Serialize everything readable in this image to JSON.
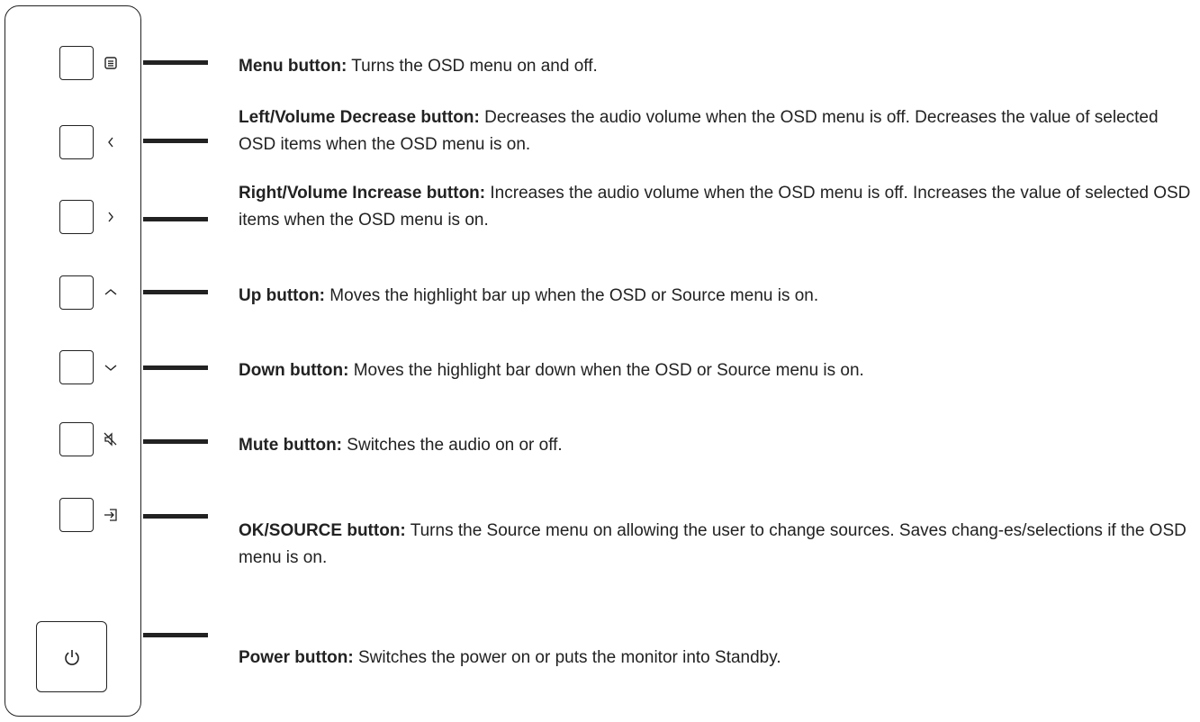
{
  "buttons": [
    {
      "id": "menu",
      "icon": "menu-icon",
      "label": "Menu button:",
      "text": "Turns the OSD menu on and off."
    },
    {
      "id": "left",
      "icon": "chevron-left-icon",
      "label": "Left/Volume Decrease button:",
      "text": "Decreases the audio volume when the OSD menu is off. Decreases the value of selected OSD items when the OSD menu is on."
    },
    {
      "id": "right",
      "icon": "chevron-right-icon",
      "label": "Right/Volume Increase button:",
      "text": "Increases the audio volume when the OSD menu is off. Increases the value of selected OSD items when the OSD menu is on."
    },
    {
      "id": "up",
      "icon": "chevron-up-icon",
      "label": "Up button:",
      "text": "Moves the highlight bar up when the OSD or Source menu is on."
    },
    {
      "id": "down",
      "icon": "chevron-down-icon",
      "label": "Down button:",
      "text": "Moves the highlight bar down when the OSD or Source menu is on."
    },
    {
      "id": "mute",
      "icon": "mute-icon",
      "label": "Mute button:",
      "text": "Switches the audio on or off."
    },
    {
      "id": "source",
      "icon": "input-source-icon",
      "label": "OK/SOURCE button:",
      "text": "Turns the Source menu on allowing the user to change sources. Saves chang-es/selections if the OSD menu is on."
    },
    {
      "id": "power",
      "icon": "power-icon",
      "label": "Power button:",
      "text": "Switches the power on or puts the monitor into Standby."
    }
  ]
}
